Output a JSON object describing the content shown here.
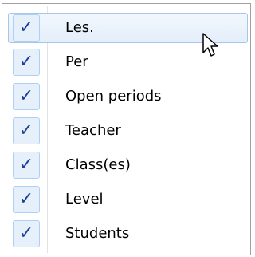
{
  "menu": {
    "items": [
      {
        "label": "Les.",
        "checked": true,
        "selected": true
      },
      {
        "label": "Per",
        "checked": true,
        "selected": false
      },
      {
        "label": "Open periods",
        "checked": true,
        "selected": false
      },
      {
        "label": "Teacher",
        "checked": true,
        "selected": false
      },
      {
        "label": "Class(es)",
        "checked": true,
        "selected": false
      },
      {
        "label": "Level",
        "checked": true,
        "selected": false
      },
      {
        "label": "Students",
        "checked": true,
        "selected": false
      }
    ],
    "check_glyph": "✓",
    "check_color": "#1c3f96",
    "highlight_border": "#a8c6e8"
  }
}
